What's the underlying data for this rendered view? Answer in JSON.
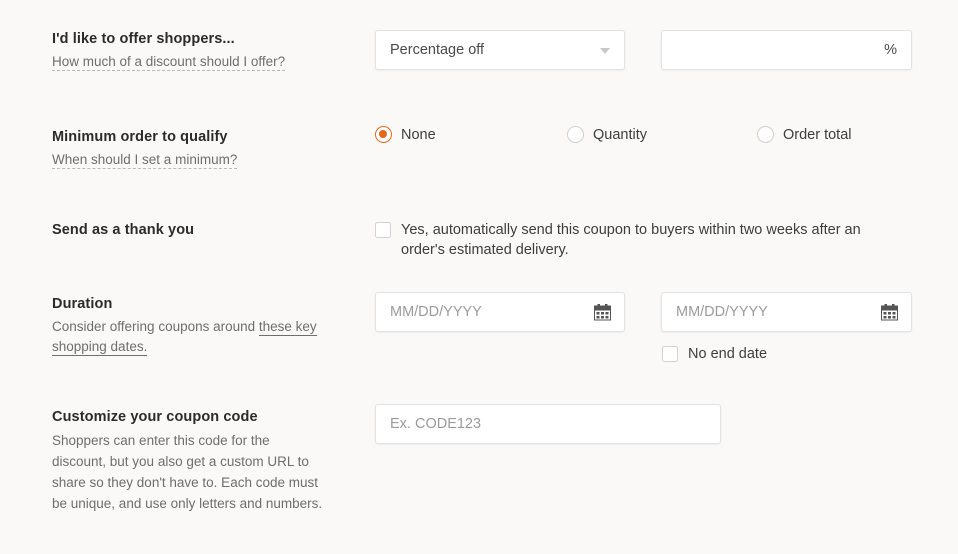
{
  "sections": {
    "offer": {
      "title": "I'd like to offer shoppers...",
      "subtitle": "How much of a discount should I offer?",
      "discount_type_value": "Percentage off",
      "discount_type_caret_icon": "chevron-down-icon",
      "amount_value": "",
      "amount_suffix": "%"
    },
    "minimum": {
      "title": "Minimum order to qualify",
      "subtitle": "When should I set a minimum?",
      "options": [
        {
          "label": "None",
          "selected": true
        },
        {
          "label": "Quantity",
          "selected": false
        },
        {
          "label": "Order total",
          "selected": false
        }
      ]
    },
    "thank_you": {
      "title": "Send as a thank you",
      "checkbox_label": "Yes, automatically send this coupon to buyers within two weeks after an order's estimated delivery.",
      "checked": false
    },
    "duration": {
      "title": "Duration",
      "subtitle_text": "Consider offering coupons around ",
      "subtitle_link": "these key shopping dates.",
      "start_placeholder": "MM/DD/YYYY",
      "end_placeholder": "MM/DD/YYYY",
      "calendar_icon": "calendar-icon",
      "no_end_date_label": "No end date",
      "no_end_date_checked": false
    },
    "coupon_code": {
      "title": "Customize your coupon code",
      "subtitle": "Shoppers can enter this code for the discount, but you also get a custom URL to share so they don't have to. Each code must be unique, and use only letters and numbers.",
      "placeholder": "Ex. CODE123",
      "value": ""
    }
  },
  "colors": {
    "accent": "#e8681a",
    "background": "#faf9f8",
    "field_border": "#e2e2e2",
    "text": "#3d3d3d",
    "muted_text": "#6e6e6e"
  }
}
